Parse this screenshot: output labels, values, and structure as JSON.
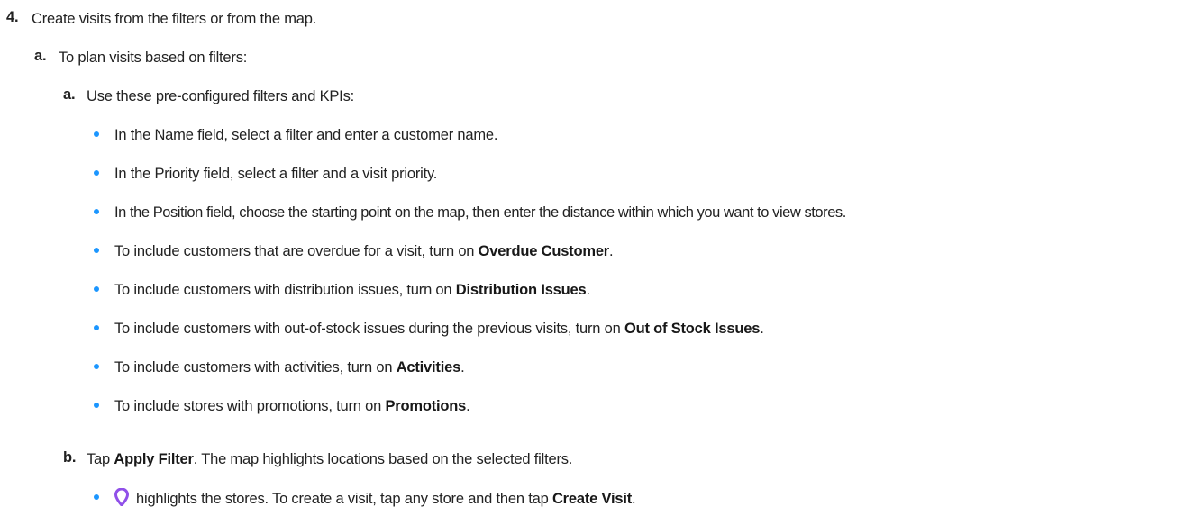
{
  "step4": {
    "marker": "4.",
    "text": "Create visits from the filters or from the map."
  },
  "sub_a": {
    "marker": "a.",
    "text": "To plan visits based on filters:"
  },
  "sub_a_a": {
    "marker": "a.",
    "text": "Use these pre-configured filters and KPIs:"
  },
  "bullets": [
    {
      "text": "In the Name field, select a filter and enter a customer name."
    },
    {
      "text": "In the Priority field, select a filter and a visit priority."
    },
    {
      "text": "In the Position field, choose the starting point on the map, then enter the distance within which you want to view stores."
    },
    {
      "prefix": "To include customers that are overdue for a visit, turn on ",
      "bold": "Overdue Customer",
      "suffix": "."
    },
    {
      "prefix": "To include customers with distribution issues, turn on ",
      "bold": "Distribution Issues",
      "suffix": "."
    },
    {
      "prefix": "To include customers with out-of-stock issues during the previous visits, turn on ",
      "bold": "Out of Stock Issues",
      "suffix": "."
    },
    {
      "prefix": "To include customers with activities, turn on ",
      "bold": "Activities",
      "suffix": "."
    },
    {
      "prefix": "To include stores with promotions, turn on ",
      "bold": "Promotions",
      "suffix": "."
    }
  ],
  "sub_b": {
    "marker": "b.",
    "prefix": "Tap ",
    "bold": "Apply Filter",
    "suffix": ". The map highlights locations based on the selected filters."
  },
  "sub_b_bullet": {
    "icon": "location-pin-icon",
    "icon_color": "#9050e9",
    "prefix": "highlights the stores. To create a visit, tap any store and then tap ",
    "bold": "Create Visit",
    "suffix": "."
  },
  "colors": {
    "bullet": "#1b96ff",
    "text": "#222222"
  }
}
